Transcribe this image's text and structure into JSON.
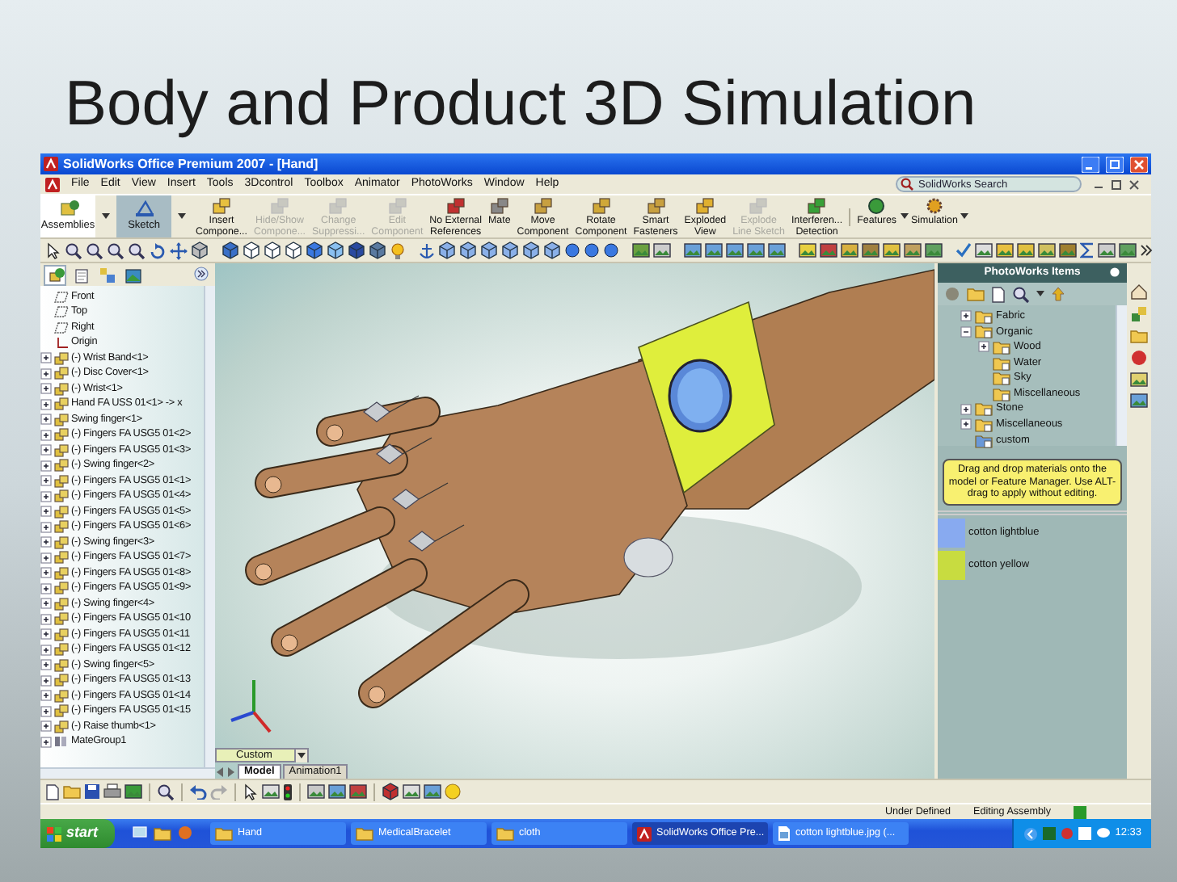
{
  "slide_title": "Body and Product 3D Simulation",
  "window": {
    "title": "SolidWorks Office Premium 2007 - [Hand]"
  },
  "menu": [
    "File",
    "Edit",
    "View",
    "Insert",
    "Tools",
    "3Dcontrol",
    "Toolbox",
    "Animator",
    "PhotoWorks",
    "Window",
    "Help"
  ],
  "search": {
    "placeholder": "SolidWorks Search"
  },
  "command_tabs": [
    {
      "label": "Assemblies",
      "selected": false
    },
    {
      "label": "Sketch",
      "selected": true
    }
  ],
  "commands": [
    {
      "label": [
        "Insert",
        "Compone..."
      ],
      "disabled": false
    },
    {
      "label": [
        "Hide/Show",
        "Compone..."
      ],
      "disabled": true
    },
    {
      "label": [
        "Change",
        "Suppressi..."
      ],
      "disabled": true
    },
    {
      "label": [
        "Edit",
        "Component"
      ],
      "disabled": true
    },
    {
      "label": [
        "No External",
        "References"
      ],
      "disabled": false
    },
    {
      "label": [
        "Mate"
      ],
      "disabled": false
    },
    {
      "label": [
        "Move",
        "Component"
      ],
      "disabled": false
    },
    {
      "label": [
        "Rotate",
        "Component"
      ],
      "disabled": false
    },
    {
      "label": [
        "Smart",
        "Fasteners"
      ],
      "disabled": false
    },
    {
      "label": [
        "Exploded",
        "View"
      ],
      "disabled": false
    },
    {
      "label": [
        "Explode",
        "Line Sketch"
      ],
      "disabled": true
    },
    {
      "label": [
        "Interferen...",
        "Detection"
      ],
      "disabled": false
    }
  ],
  "command_menus": [
    {
      "label": "Features"
    },
    {
      "label": "Simulation"
    }
  ],
  "feature_tree": {
    "tabs": [
      {
        "selected": true
      },
      {
        "selected": false
      },
      {
        "selected": false
      },
      {
        "selected": false
      }
    ],
    "items": [
      {
        "kind": "plane",
        "label": "Front"
      },
      {
        "kind": "plane",
        "label": "Top"
      },
      {
        "kind": "plane",
        "label": "Right"
      },
      {
        "kind": "origin",
        "label": "Origin"
      },
      {
        "kind": "component",
        "label": "(-) Wrist Band<1>",
        "expanded": false
      },
      {
        "kind": "component",
        "label": "(-) Disc Cover<1>",
        "expanded": false
      },
      {
        "kind": "component",
        "label": "(-) Wrist<1>",
        "expanded": false
      },
      {
        "kind": "component",
        "label": "Hand FA USS 01<1> -> x",
        "expanded": false
      },
      {
        "kind": "component",
        "label": "Swing finger<1>",
        "expanded": false
      },
      {
        "kind": "component",
        "label": "(-) Fingers FA USG5 01<2>",
        "expanded": false
      },
      {
        "kind": "component",
        "label": "(-) Fingers FA USG5 01<3>",
        "expanded": false
      },
      {
        "kind": "component",
        "label": "(-) Swing finger<2>",
        "expanded": false
      },
      {
        "kind": "component",
        "label": "(-) Fingers FA USG5 01<1>",
        "expanded": false
      },
      {
        "kind": "component",
        "label": "(-) Fingers FA USG5 01<4>",
        "expanded": false
      },
      {
        "kind": "component",
        "label": "(-) Fingers FA USG5 01<5>",
        "expanded": false
      },
      {
        "kind": "component",
        "label": "(-) Fingers FA USG5 01<6>",
        "expanded": false
      },
      {
        "kind": "component",
        "label": "(-) Swing finger<3>",
        "expanded": false
      },
      {
        "kind": "component",
        "label": "(-) Fingers FA USG5 01<7>",
        "expanded": false
      },
      {
        "kind": "component",
        "label": "(-) Fingers FA USG5 01<8>",
        "expanded": false
      },
      {
        "kind": "component",
        "label": "(-) Fingers FA USG5 01<9>",
        "expanded": false
      },
      {
        "kind": "component",
        "label": "(-) Swing finger<4>",
        "expanded": false
      },
      {
        "kind": "component",
        "label": "(-) Fingers FA USG5 01<10",
        "expanded": false
      },
      {
        "kind": "component",
        "label": "(-) Fingers FA USG5 01<11",
        "expanded": false
      },
      {
        "kind": "component",
        "label": "(-) Fingers FA USG5 01<12",
        "expanded": false
      },
      {
        "kind": "component",
        "label": "(-) Swing finger<5>",
        "expanded": false
      },
      {
        "kind": "component",
        "label": "(-) Fingers FA USG5 01<13",
        "expanded": false
      },
      {
        "kind": "component",
        "label": "(-) Fingers FA USG5 01<14",
        "expanded": false
      },
      {
        "kind": "component",
        "label": "(-) Fingers FA USG5 01<15",
        "expanded": false
      },
      {
        "kind": "component",
        "label": "(-) Raise thumb<1>",
        "expanded": false
      },
      {
        "kind": "mates",
        "label": "MateGroup1",
        "expanded": false
      }
    ]
  },
  "viewport": {
    "display_state": "Custom",
    "tabs": [
      {
        "label": "Model",
        "selected": true
      },
      {
        "label": "Animation1",
        "selected": false
      }
    ]
  },
  "photoworks": {
    "title": "PhotoWorks Items",
    "tree": [
      {
        "label": "Fabric",
        "kind": "folder",
        "expanded": false
      },
      {
        "label": "Organic",
        "kind": "folder",
        "expanded": true,
        "children": [
          {
            "label": "Wood",
            "kind": "folder",
            "expanded": false
          },
          {
            "label": "Water",
            "kind": "folder"
          },
          {
            "label": "Sky",
            "kind": "folder"
          },
          {
            "label": "Miscellaneous",
            "kind": "folder"
          }
        ]
      },
      {
        "label": "Stone",
        "kind": "folder",
        "expanded": false
      },
      {
        "label": "Miscellaneous",
        "kind": "folder",
        "expanded": false
      },
      {
        "label": "custom",
        "kind": "custom"
      }
    ],
    "tip": "Drag and drop materials onto the model or Feature Manager.  Use ALT-drag to apply without editing.",
    "materials": [
      {
        "label": "cotton lightblue",
        "color": "#88aaf0"
      },
      {
        "label": "cotton yellow",
        "color": "#c8dc40"
      }
    ]
  },
  "status_bar": [
    "Under Defined",
    "Editing Assembly"
  ],
  "taskbar": {
    "start": "start",
    "buttons": [
      {
        "label": "Hand",
        "kind": "folder",
        "selected": false
      },
      {
        "label": "MedicalBracelet",
        "kind": "folder",
        "selected": false
      },
      {
        "label": "cloth",
        "kind": "folder",
        "selected": false
      },
      {
        "label": "SolidWorks Office Pre...",
        "kind": "app",
        "selected": true
      },
      {
        "label": "cotton lightblue.jpg (...",
        "kind": "image",
        "selected": false
      }
    ],
    "clock": "12:33"
  }
}
